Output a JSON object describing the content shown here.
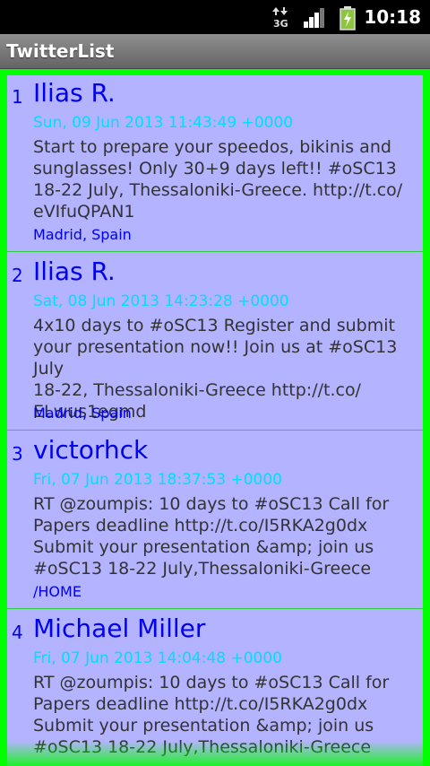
{
  "status_bar": {
    "network": "3G",
    "time": "10:18",
    "icons": [
      "data-transfer-icon",
      "signal-icon",
      "battery-charging-icon"
    ]
  },
  "app": {
    "title": "TwitterList"
  },
  "colors": {
    "frame": "#00ff00",
    "list_bg": "#b3b3ff",
    "user": "#0000ee",
    "date": "#00ddff",
    "text": "#333333",
    "divider": "#2ecc40"
  },
  "tweets": [
    {
      "index": "1",
      "user": "Ilias R.",
      "date": "Sun, 09 Jun 2013 11:43:49 +0000",
      "text": "Start to prepare your speedos, bikinis and\nsunglasses! Only 30+9 days left!! #oSC13\n18-22 July, Thessaloniki-Greece. http://t.co/\neVIfuQPAN1",
      "location": "Madrid, Spain"
    },
    {
      "index": "2",
      "user": "Ilias R.",
      "date": "Sat, 08 Jun 2013 14:23:28 +0000",
      "text": "4x10 days to #oSC13 Register and submit\nyour presentation now!! Join us at #oSC13 July\n18-22, Thessaloniki-Greece http://t.co/\nELwus1egmd",
      "location": "Madrid, Spain"
    },
    {
      "index": "3",
      "user": "victorhck",
      "date": "Fri, 07 Jun 2013 18:37:53 +0000",
      "text": "RT @zoumpis: 10 days to #oSC13 Call for\nPapers deadline http://t.co/I5RKA2g0dx\nSubmit your presentation &amp; join us\n#oSC13 18-22 July,Thessaloniki-Greece",
      "location": "/HOME"
    },
    {
      "index": "4",
      "user": "Michael Miller",
      "date": "Fri, 07 Jun 2013 14:04:48 +0000",
      "text": "RT @zoumpis: 10 days to #oSC13 Call for\nPapers deadline http://t.co/I5RKA2g0dx\nSubmit your presentation &amp; join us\n#oSC13 18-22 July,Thessaloniki-Greece",
      "location": ""
    }
  ]
}
